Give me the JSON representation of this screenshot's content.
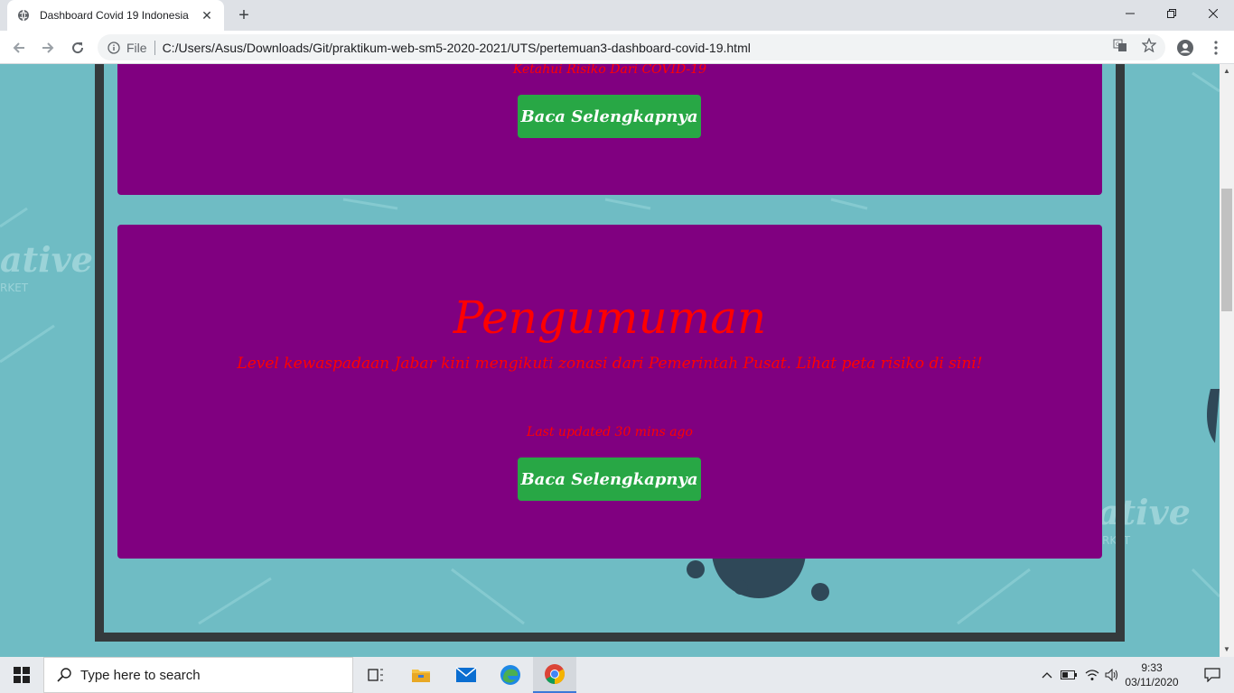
{
  "browser": {
    "tab_title": "Dashboard Covid 19 Indonesia",
    "new_tab": "+",
    "address_scheme": "File",
    "address_url": "C:/Users/Asus/Downloads/Git/praktikum-web-sm5-2020-2021/UTS/pertemuan3-dashboard-covid-19.html"
  },
  "page": {
    "card1": {
      "caption": "Ketahui Risiko Dari COVID-19",
      "button": "Baca Selengkapnya"
    },
    "card2": {
      "title": "Pengumuman",
      "description": "Level kewaspadaan Jabar kini mengikuti zonasi dari Pemerintah Pusat. Lihat peta risiko di sini!",
      "updated": "Last updated 30 mins ago",
      "button": "Baca Selengkapnya"
    },
    "colors": {
      "card_bg": "#800080",
      "text_red": "#ff0000",
      "button_green": "#28a745",
      "page_bg": "#6fbcc4",
      "frame": "#343a3c"
    }
  },
  "taskbar": {
    "search_placeholder": "Type here to search",
    "time": "9:33",
    "date": "03/11/2020"
  }
}
